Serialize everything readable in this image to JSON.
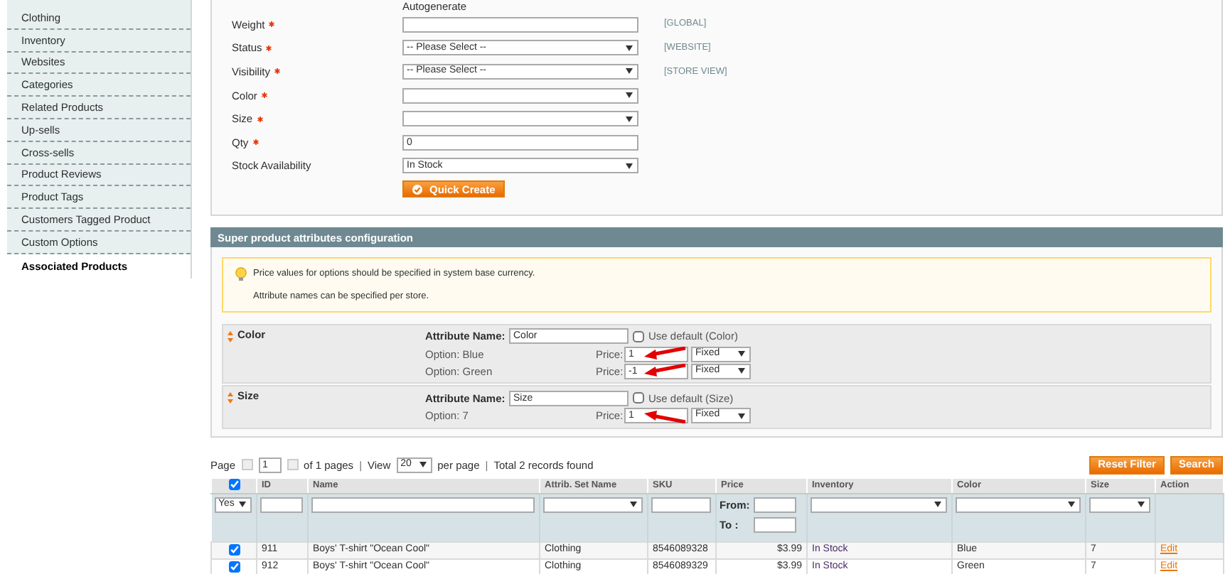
{
  "sidebar": {
    "items": [
      {
        "label": "Clothing",
        "selected": false
      },
      {
        "label": "Inventory",
        "selected": false
      },
      {
        "label": "Websites",
        "selected": false
      },
      {
        "label": "Categories",
        "selected": false
      },
      {
        "label": "Related Products",
        "selected": false
      },
      {
        "label": "Up-sells",
        "selected": false
      },
      {
        "label": "Cross-sells",
        "selected": false
      },
      {
        "label": "Product Reviews",
        "selected": false
      },
      {
        "label": "Product Tags",
        "selected": false
      },
      {
        "label": "Customers Tagged Product",
        "selected": false
      },
      {
        "label": "Custom Options",
        "selected": false
      },
      {
        "label": "Associated Products",
        "selected": true
      }
    ]
  },
  "quick_create": {
    "note": "Autogenerate",
    "fields": [
      {
        "label": "Weight",
        "required": true,
        "kind": "text",
        "scope": "[GLOBAL]"
      },
      {
        "label": "Status",
        "required": true,
        "kind": "select",
        "value": "-- Please Select --",
        "scope": "[WEBSITE]"
      },
      {
        "label": "Visibility",
        "required": true,
        "kind": "select",
        "value": "-- Please Select --",
        "scope": "[STORE VIEW]"
      },
      {
        "label": "Color",
        "required": true,
        "kind": "select"
      },
      {
        "label": "Size",
        "required": true,
        "kind": "select"
      },
      {
        "label": "Qty",
        "required": true,
        "kind": "text",
        "value": "0"
      },
      {
        "label": "Stock Availability",
        "required": false,
        "kind": "select",
        "value": "In Stock"
      }
    ],
    "button": "Quick Create"
  },
  "super_config": {
    "title": "Super product attributes configuration",
    "notices": [
      "Price values for options should be specified in system base currency.",
      "Attribute names can be specified per store."
    ],
    "attributes": [
      {
        "label": "Color",
        "name_label": "Attribute Name:",
        "name_value": "Color",
        "use_default": "Use default (Color)",
        "use_default_checked": false,
        "options": [
          {
            "label": "Option: Blue",
            "price_label": "Price:",
            "price": "1",
            "price_type": "Fixed",
            "arrow": true
          },
          {
            "label": "Option: Green",
            "price_label": "Price:",
            "price": "-1",
            "price_type": "Fixed",
            "arrow": true
          }
        ]
      },
      {
        "label": "Size",
        "name_label": "Attribute Name:",
        "name_value": "Size",
        "use_default": "Use default (Size)",
        "use_default_checked": false,
        "options": [
          {
            "label": "Option: 7",
            "price_label": "Price:",
            "price": "1",
            "price_type": "Fixed",
            "arrow": true
          }
        ]
      }
    ]
  },
  "grid": {
    "pager": {
      "page_label": "Page",
      "page": "1",
      "of_pages": "of 1 pages",
      "separator_1": "|",
      "view_label": "View",
      "per_page": "20",
      "per_page_label": "per page",
      "separator_2": "|",
      "total": "Total 2 records found"
    },
    "buttons": [
      "Reset Filter",
      "Search"
    ],
    "select_column": {
      "checked": true,
      "filter_value": "Yes"
    },
    "columns": [
      {
        "label": "ID",
        "kind": "text"
      },
      {
        "label": "Name",
        "kind": "text"
      },
      {
        "label": "Attrib. Set Name",
        "kind": "select"
      },
      {
        "label": "SKU",
        "kind": "text"
      },
      {
        "label": "Price",
        "kind": "range",
        "from_label": "From:",
        "to_label": "To :"
      },
      {
        "label": "Inventory",
        "kind": "select"
      },
      {
        "label": "Color",
        "kind": "select"
      },
      {
        "label": "Size",
        "kind": "select"
      },
      {
        "label": "Action",
        "kind": "none"
      }
    ],
    "rows": [
      {
        "checked": true,
        "cells": [
          "911",
          "Boys' T-shirt \"Ocean Cool\"",
          "Clothing",
          "8546089328",
          "$3.99",
          "In Stock",
          "Blue",
          "7"
        ],
        "action": "Edit"
      },
      {
        "checked": true,
        "cells": [
          "912",
          "Boys' T-shirt \"Ocean Cool\"",
          "Clothing",
          "8546089329",
          "$3.99",
          "In Stock",
          "Green",
          "7"
        ],
        "action": "Edit"
      }
    ]
  }
}
